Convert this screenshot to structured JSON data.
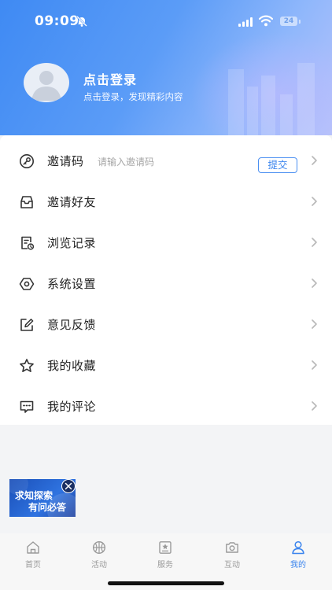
{
  "status_bar": {
    "time": "09:09",
    "battery": "24"
  },
  "profile": {
    "login_title": "点击登录",
    "login_subtitle": "点击登录，发现精彩内容"
  },
  "menu": {
    "invite_code": {
      "label": "邀请码",
      "placeholder": "请输入邀请码",
      "submit_label": "提交"
    },
    "items": [
      {
        "label": "邀请好友",
        "icon": "inbox-icon"
      },
      {
        "label": "浏览记录",
        "icon": "history-icon"
      },
      {
        "label": "系统设置",
        "icon": "settings-icon"
      },
      {
        "label": "意见反馈",
        "icon": "edit-icon"
      },
      {
        "label": "我的收藏",
        "icon": "star-icon"
      },
      {
        "label": "我的评论",
        "icon": "comment-icon"
      }
    ]
  },
  "ad": {
    "line1": "求知探索",
    "line2": "有问必答"
  },
  "tabbar": {
    "tabs": [
      {
        "label": "首页",
        "icon": "home-icon"
      },
      {
        "label": "活动",
        "icon": "basketball-icon"
      },
      {
        "label": "服务",
        "icon": "service-icon"
      },
      {
        "label": "互动",
        "icon": "camera-icon"
      },
      {
        "label": "我的",
        "icon": "user-icon"
      }
    ],
    "active_index": 4
  },
  "colors": {
    "accent": "#3a84ee",
    "header_start": "#3f8af3",
    "header_end": "#b7c2fb"
  }
}
